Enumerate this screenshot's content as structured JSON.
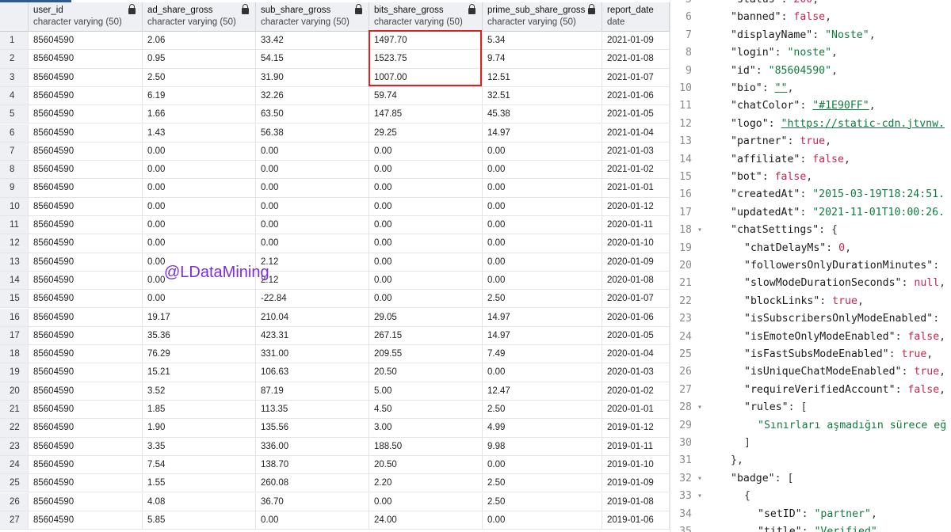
{
  "grid": {
    "columns": [
      {
        "name": "",
        "type": ""
      },
      {
        "name": "user_id",
        "type": "character varying (50)"
      },
      {
        "name": "ad_share_gross",
        "type": "character varying (50)"
      },
      {
        "name": "sub_share_gross",
        "type": "character varying (50)"
      },
      {
        "name": "bits_share_gross",
        "type": "character varying (50)"
      },
      {
        "name": "prime_sub_share_gross",
        "type": "character varying (50)"
      },
      {
        "name": "report_date",
        "type": "date"
      }
    ],
    "rows": [
      [
        "1",
        "85604590",
        "2.06",
        "33.42",
        "1497.70",
        "5.34",
        "2021-01-09"
      ],
      [
        "2",
        "85604590",
        "0.95",
        "54.15",
        "1523.75",
        "9.74",
        "2021-01-08"
      ],
      [
        "3",
        "85604590",
        "2.50",
        "31.90",
        "1007.00",
        "12.51",
        "2021-01-07"
      ],
      [
        "4",
        "85604590",
        "6.19",
        "32.26",
        "59.74",
        "32.51",
        "2021-01-06"
      ],
      [
        "5",
        "85604590",
        "1.66",
        "63.50",
        "147.85",
        "45.38",
        "2021-01-05"
      ],
      [
        "6",
        "85604590",
        "1.43",
        "56.38",
        "29.25",
        "14.97",
        "2021-01-04"
      ],
      [
        "7",
        "85604590",
        "0.00",
        "0.00",
        "0.00",
        "0.00",
        "2021-01-03"
      ],
      [
        "8",
        "85604590",
        "0.00",
        "0.00",
        "0.00",
        "0.00",
        "2021-01-02"
      ],
      [
        "9",
        "85604590",
        "0.00",
        "0.00",
        "0.00",
        "0.00",
        "2021-01-01"
      ],
      [
        "10",
        "85604590",
        "0.00",
        "0.00",
        "0.00",
        "0.00",
        "2020-01-12"
      ],
      [
        "11",
        "85604590",
        "0.00",
        "0.00",
        "0.00",
        "0.00",
        "2020-01-11"
      ],
      [
        "12",
        "85604590",
        "0.00",
        "0.00",
        "0.00",
        "0.00",
        "2020-01-10"
      ],
      [
        "13",
        "85604590",
        "0.00",
        "2.12",
        "0.00",
        "0.00",
        "2020-01-09"
      ],
      [
        "14",
        "85604590",
        "0.00",
        "2.12",
        "0.00",
        "0.00",
        "2020-01-08"
      ],
      [
        "15",
        "85604590",
        "0.00",
        "-22.84",
        "0.00",
        "2.50",
        "2020-01-07"
      ],
      [
        "16",
        "85604590",
        "19.17",
        "210.04",
        "29.05",
        "14.97",
        "2020-01-06"
      ],
      [
        "17",
        "85604590",
        "35.36",
        "423.31",
        "267.15",
        "14.97",
        "2020-01-05"
      ],
      [
        "18",
        "85604590",
        "76.29",
        "331.00",
        "209.55",
        "7.49",
        "2020-01-04"
      ],
      [
        "19",
        "85604590",
        "15.21",
        "106.63",
        "20.50",
        "0.00",
        "2020-01-03"
      ],
      [
        "20",
        "85604590",
        "3.52",
        "87.19",
        "5.00",
        "12.47",
        "2020-01-02"
      ],
      [
        "21",
        "85604590",
        "1.85",
        "113.35",
        "4.50",
        "2.50",
        "2020-01-01"
      ],
      [
        "22",
        "85604590",
        "1.90",
        "135.56",
        "3.00",
        "4.99",
        "2019-01-12"
      ],
      [
        "23",
        "85604590",
        "3.35",
        "336.00",
        "188.50",
        "9.98",
        "2019-01-11"
      ],
      [
        "24",
        "85604590",
        "7.54",
        "138.70",
        "20.50",
        "0.00",
        "2019-01-10"
      ],
      [
        "25",
        "85604590",
        "1.55",
        "260.08",
        "2.20",
        "2.50",
        "2019-01-09"
      ],
      [
        "26",
        "85604590",
        "4.08",
        "36.70",
        "0.00",
        "2.50",
        "2019-01-08"
      ],
      [
        "27",
        "85604590",
        "5.85",
        "0.00",
        "24.00",
        "0.00",
        "2019-01-06"
      ]
    ],
    "watermark": "@LDataMining"
  },
  "editor": {
    "lines": [
      {
        "n": "5",
        "fold": "",
        "indent": 1,
        "tokens": [
          [
            "key",
            "\"status\""
          ],
          [
            "pun",
            ": "
          ],
          [
            "num",
            "200"
          ],
          [
            "pun",
            ","
          ]
        ]
      },
      {
        "n": "6",
        "fold": "",
        "indent": 1,
        "tokens": [
          [
            "key",
            "\"banned\""
          ],
          [
            "pun",
            ": "
          ],
          [
            "bool",
            "false"
          ],
          [
            "pun",
            ","
          ]
        ]
      },
      {
        "n": "7",
        "fold": "",
        "indent": 1,
        "tokens": [
          [
            "key",
            "\"displayName\""
          ],
          [
            "pun",
            ": "
          ],
          [
            "str",
            "\"Noste\""
          ],
          [
            "pun",
            ","
          ]
        ]
      },
      {
        "n": "8",
        "fold": "",
        "indent": 1,
        "tokens": [
          [
            "key",
            "\"login\""
          ],
          [
            "pun",
            ": "
          ],
          [
            "str",
            "\"noste\""
          ],
          [
            "pun",
            ","
          ]
        ]
      },
      {
        "n": "9",
        "fold": "",
        "indent": 1,
        "tokens": [
          [
            "key",
            "\"id\""
          ],
          [
            "pun",
            ": "
          ],
          [
            "str",
            "\"85604590\""
          ],
          [
            "pun",
            ","
          ]
        ]
      },
      {
        "n": "10",
        "fold": "",
        "indent": 1,
        "tokens": [
          [
            "key",
            "\"bio\""
          ],
          [
            "pun",
            ": "
          ],
          [
            "url",
            "\"\""
          ],
          [
            "pun",
            ","
          ]
        ]
      },
      {
        "n": "11",
        "fold": "",
        "indent": 1,
        "tokens": [
          [
            "key",
            "\"chatColor\""
          ],
          [
            "pun",
            ": "
          ],
          [
            "url",
            "\"#1E90FF\""
          ],
          [
            "pun",
            ","
          ]
        ]
      },
      {
        "n": "12",
        "fold": "",
        "indent": 1,
        "tokens": [
          [
            "key",
            "\"logo\""
          ],
          [
            "pun",
            ": "
          ],
          [
            "url",
            "\"https://static-cdn.jtvnw."
          ]
        ]
      },
      {
        "n": "13",
        "fold": "",
        "indent": 1,
        "tokens": [
          [
            "key",
            "\"partner\""
          ],
          [
            "pun",
            ": "
          ],
          [
            "bool",
            "true"
          ],
          [
            "pun",
            ","
          ]
        ]
      },
      {
        "n": "14",
        "fold": "",
        "indent": 1,
        "tokens": [
          [
            "key",
            "\"affiliate\""
          ],
          [
            "pun",
            ": "
          ],
          [
            "bool",
            "false"
          ],
          [
            "pun",
            ","
          ]
        ]
      },
      {
        "n": "15",
        "fold": "",
        "indent": 1,
        "tokens": [
          [
            "key",
            "\"bot\""
          ],
          [
            "pun",
            ": "
          ],
          [
            "bool",
            "false"
          ],
          [
            "pun",
            ","
          ]
        ]
      },
      {
        "n": "16",
        "fold": "",
        "indent": 1,
        "tokens": [
          [
            "key",
            "\"createdAt\""
          ],
          [
            "pun",
            ": "
          ],
          [
            "str",
            "\"2015-03-19T18:24:51."
          ]
        ]
      },
      {
        "n": "17",
        "fold": "",
        "indent": 1,
        "tokens": [
          [
            "key",
            "\"updatedAt\""
          ],
          [
            "pun",
            ": "
          ],
          [
            "str",
            "\"2021-11-01T10:00:26."
          ]
        ]
      },
      {
        "n": "18",
        "fold": "▾",
        "indent": 1,
        "tokens": [
          [
            "key",
            "\"chatSettings\""
          ],
          [
            "pun",
            ": {"
          ]
        ]
      },
      {
        "n": "19",
        "fold": "",
        "indent": 2,
        "tokens": [
          [
            "key",
            "\"chatDelayMs\""
          ],
          [
            "pun",
            ": "
          ],
          [
            "num",
            "0"
          ],
          [
            "pun",
            ","
          ]
        ]
      },
      {
        "n": "20",
        "fold": "",
        "indent": 2,
        "tokens": [
          [
            "key",
            "\"followersOnlyDurationMinutes\""
          ],
          [
            "pun",
            ":"
          ]
        ]
      },
      {
        "n": "21",
        "fold": "",
        "indent": 2,
        "tokens": [
          [
            "key",
            "\"slowModeDurationSeconds\""
          ],
          [
            "pun",
            ": "
          ],
          [
            "bool",
            "null"
          ],
          [
            "pun",
            ","
          ]
        ]
      },
      {
        "n": "22",
        "fold": "",
        "indent": 2,
        "tokens": [
          [
            "key",
            "\"blockLinks\""
          ],
          [
            "pun",
            ": "
          ],
          [
            "bool",
            "true"
          ],
          [
            "pun",
            ","
          ]
        ]
      },
      {
        "n": "23",
        "fold": "",
        "indent": 2,
        "tokens": [
          [
            "key",
            "\"isSubscribersOnlyModeEnabled\""
          ],
          [
            "pun",
            ":"
          ]
        ]
      },
      {
        "n": "24",
        "fold": "",
        "indent": 2,
        "tokens": [
          [
            "key",
            "\"isEmoteOnlyModeEnabled\""
          ],
          [
            "pun",
            ": "
          ],
          [
            "bool",
            "false"
          ],
          [
            "pun",
            ","
          ]
        ]
      },
      {
        "n": "25",
        "fold": "",
        "indent": 2,
        "tokens": [
          [
            "key",
            "\"isFastSubsModeEnabled\""
          ],
          [
            "pun",
            ": "
          ],
          [
            "bool",
            "true"
          ],
          [
            "pun",
            ","
          ]
        ]
      },
      {
        "n": "26",
        "fold": "",
        "indent": 2,
        "tokens": [
          [
            "key",
            "\"isUniqueChatModeEnabled\""
          ],
          [
            "pun",
            ": "
          ],
          [
            "bool",
            "true"
          ],
          [
            "pun",
            ","
          ]
        ]
      },
      {
        "n": "27",
        "fold": "",
        "indent": 2,
        "tokens": [
          [
            "key",
            "\"requireVerifiedAccount\""
          ],
          [
            "pun",
            ": "
          ],
          [
            "bool",
            "false"
          ],
          [
            "pun",
            ","
          ]
        ]
      },
      {
        "n": "28",
        "fold": "▾",
        "indent": 2,
        "tokens": [
          [
            "key",
            "\"rules\""
          ],
          [
            "pun",
            ": ["
          ]
        ]
      },
      {
        "n": "29",
        "fold": "",
        "indent": 3,
        "tokens": [
          [
            "str",
            "\"Sınırları aşmadığın sürece eğ"
          ]
        ]
      },
      {
        "n": "30",
        "fold": "",
        "indent": 2,
        "tokens": [
          [
            "pun",
            "]"
          ]
        ]
      },
      {
        "n": "31",
        "fold": "",
        "indent": 1,
        "tokens": [
          [
            "pun",
            "},"
          ]
        ]
      },
      {
        "n": "32",
        "fold": "▾",
        "indent": 1,
        "tokens": [
          [
            "key",
            "\"badge\""
          ],
          [
            "pun",
            ": ["
          ]
        ]
      },
      {
        "n": "33",
        "fold": "▾",
        "indent": 2,
        "tokens": [
          [
            "pun",
            "{"
          ]
        ]
      },
      {
        "n": "34",
        "fold": "",
        "indent": 3,
        "tokens": [
          [
            "key",
            "\"setID\""
          ],
          [
            "pun",
            ": "
          ],
          [
            "str",
            "\"partner\""
          ],
          [
            "pun",
            ","
          ]
        ]
      },
      {
        "n": "35",
        "fold": "",
        "indent": 3,
        "tokens": [
          [
            "key",
            "\"title\""
          ],
          [
            "pun",
            ": "
          ],
          [
            "str",
            "\"Verified\""
          ]
        ]
      }
    ]
  }
}
